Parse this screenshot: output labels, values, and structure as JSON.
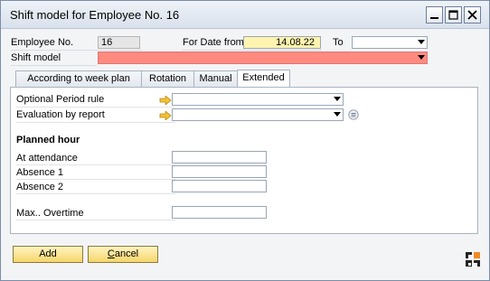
{
  "window": {
    "title": "Shift model for Employee No. 16",
    "controls": [
      "minimize-icon",
      "maximize-icon",
      "close-icon"
    ]
  },
  "header": {
    "employee_no_label": "Employee No.",
    "employee_no_value": "16",
    "for_date_from_label": "For Date from",
    "for_date_from_value": "14.08.22",
    "to_label": "To",
    "to_value": "",
    "shift_model_label": "Shift model",
    "shift_model_value": ""
  },
  "tabs": [
    {
      "label": "According to week plan",
      "active": false
    },
    {
      "label": "Rotation",
      "active": false
    },
    {
      "label": "Manual",
      "active": false
    },
    {
      "label": "Extended",
      "active": true
    }
  ],
  "extended": {
    "optional_period_rule_label": "Optional Period rule",
    "optional_period_rule_value": "",
    "evaluation_by_report_label": "Evaluation by report",
    "evaluation_by_report_value": "",
    "planned_hour_title": "Planned hour",
    "at_attendance_label": "At attendance",
    "at_attendance_value": "",
    "absence1_label": "Absence 1",
    "absence1_value": "",
    "absence2_label": "Absence 2",
    "absence2_value": "",
    "max_overtime_label": "Max.. Overtime",
    "max_overtime_value": ""
  },
  "buttons": {
    "add_label": "Add",
    "cancel_label_prefix": "C",
    "cancel_label_rest": "ancel"
  },
  "colors": {
    "mandatory_field": "#ff8a80",
    "date_field": "#fff3b0",
    "button_gold": "#f6d66a"
  }
}
